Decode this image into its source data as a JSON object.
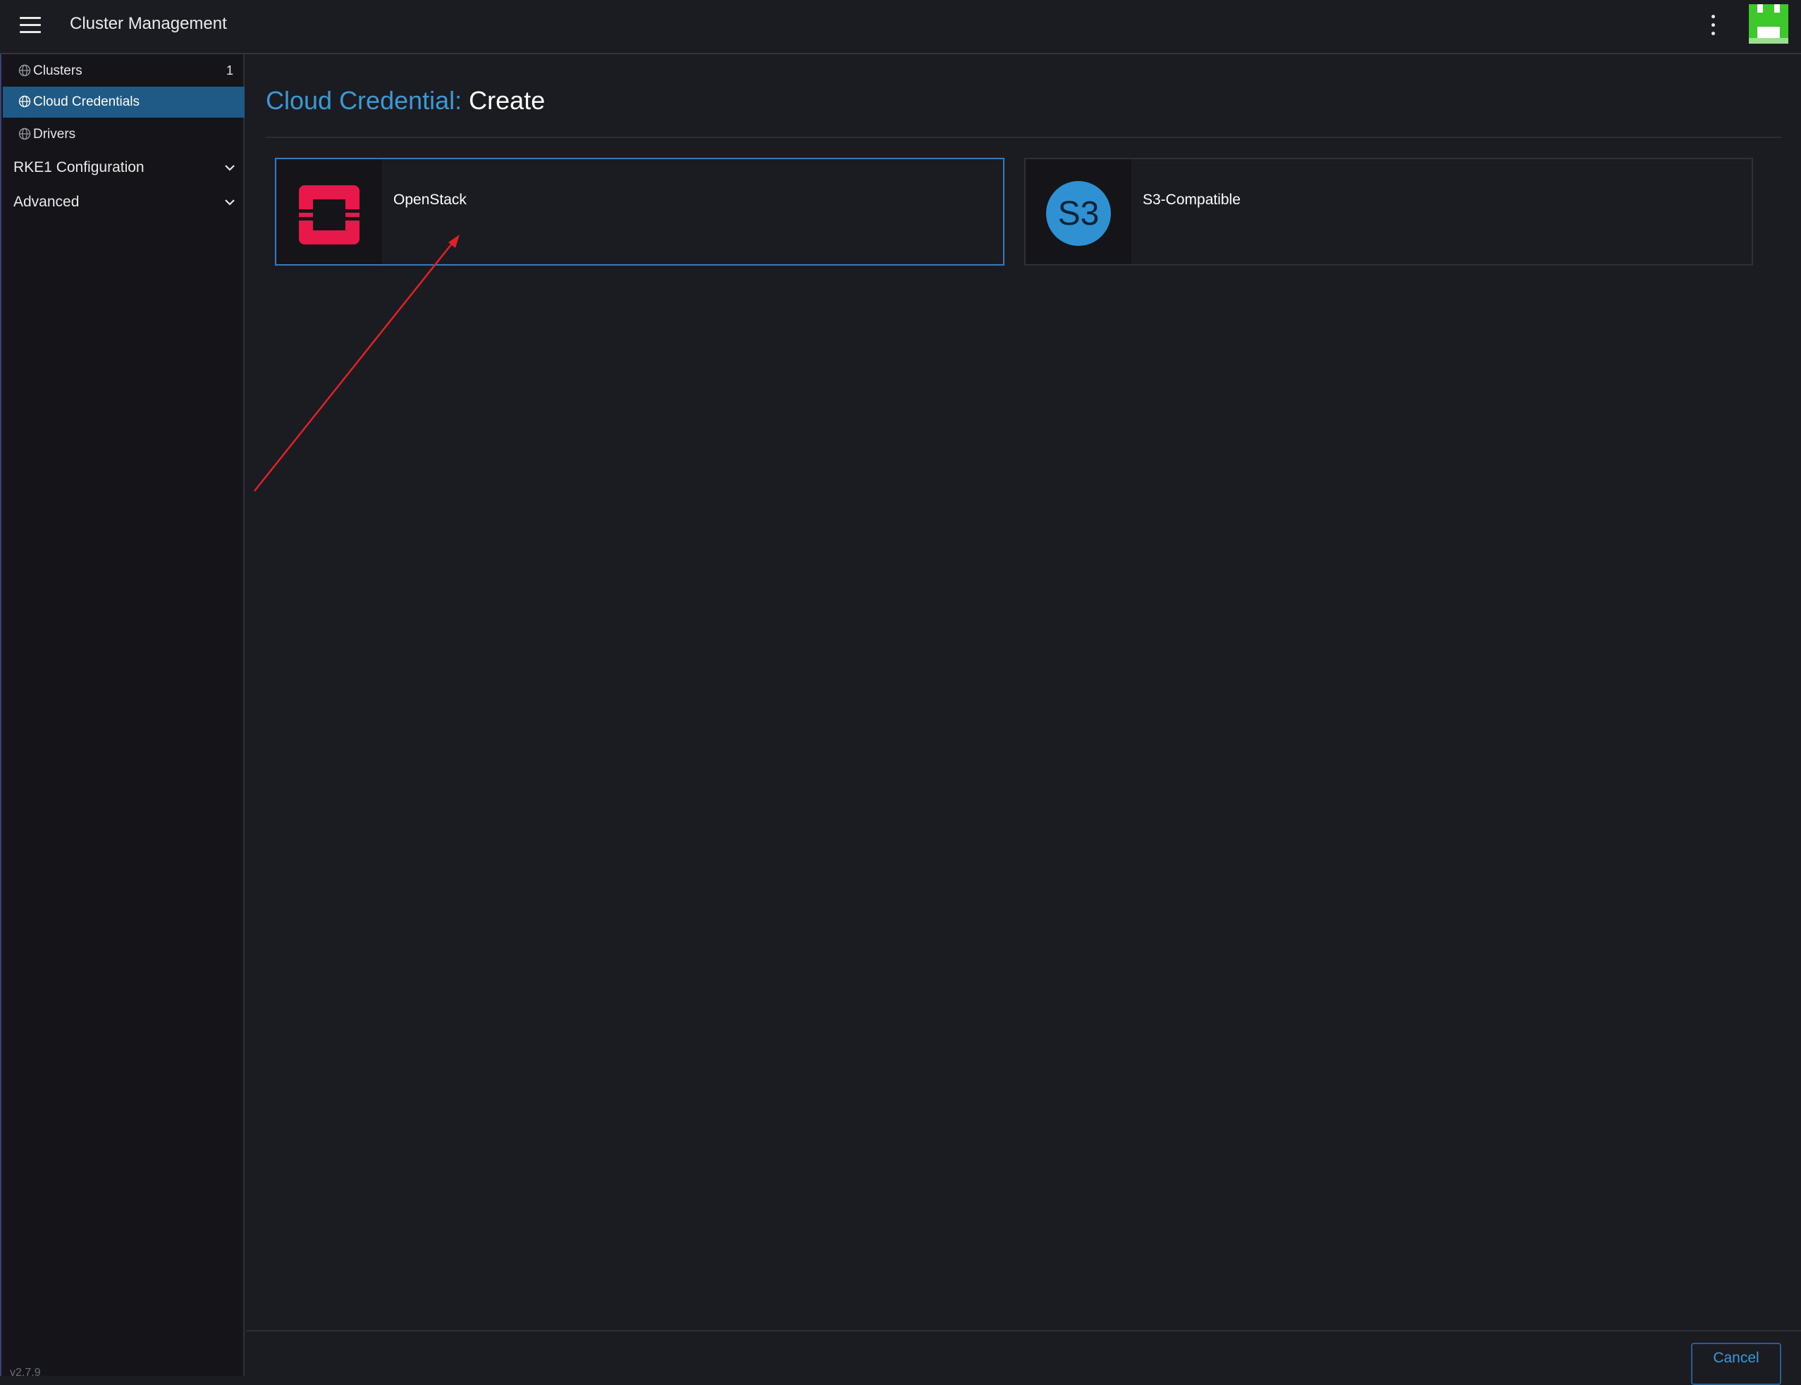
{
  "header": {
    "title": "Cluster Management",
    "menu_icon": "hamburger-icon",
    "more_icon": "kebab-menu-icon",
    "avatar_icon": "user-avatar",
    "avatar_color": "#3ec92a"
  },
  "sidebar": {
    "items": [
      {
        "label": "Clusters",
        "count": "1",
        "icon": "globe-icon"
      },
      {
        "label": "Cloud Credentials",
        "count": "",
        "icon": "globe-icon",
        "active": true
      },
      {
        "label": "Drivers",
        "count": "",
        "icon": "globe-icon"
      }
    ],
    "groups": [
      {
        "label": "RKE1 Configuration",
        "icon": "chevron-down-icon"
      },
      {
        "label": "Advanced",
        "icon": "chevron-down-icon"
      }
    ],
    "version": "v2.7.9"
  },
  "page": {
    "title_prefix": "Cloud Credential:",
    "title_suffix": "Create"
  },
  "providers": [
    {
      "name": "OpenStack",
      "logo": "openstack-logo",
      "logo_color": "#e8184a",
      "selected": true
    },
    {
      "name": "S3-Compatible",
      "logo": "s3-logo",
      "logo_text": "S3",
      "logo_color": "#2f90d2",
      "selected": false
    }
  ],
  "footer": {
    "cancel_label": "Cancel"
  },
  "colors": {
    "accent": "#3d98d3",
    "active_nav": "#1f5a86",
    "background": "#1b1c21",
    "annotation_arrow": "#e0202a"
  }
}
